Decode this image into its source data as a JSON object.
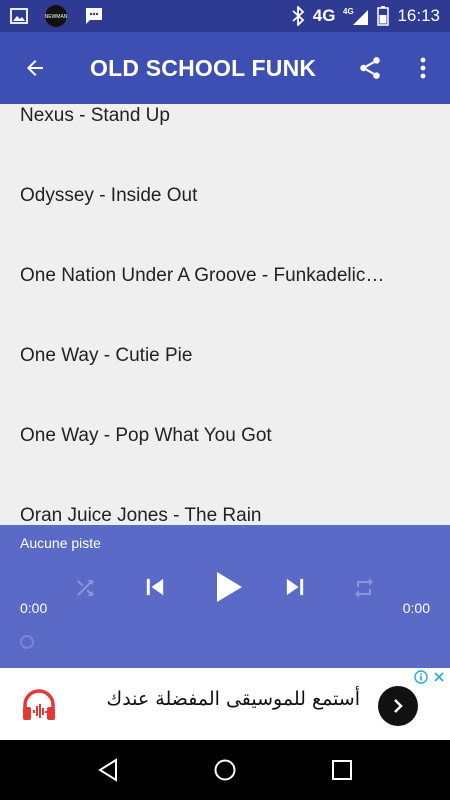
{
  "status_bar": {
    "network": "4G",
    "network_small": "4G",
    "time": "16:13",
    "notification_label": "NEWMAN"
  },
  "app_bar": {
    "title": "OLD SCHOOL FUNK"
  },
  "tracks": [
    "Nexus - Stand Up",
    "Odyssey - Inside Out",
    "One Nation Under A Groove - Funkadelic…",
    "One Way - Cutie Pie",
    "One Way - Pop What You Got",
    "Oran Juice Jones - The Rain"
  ],
  "player": {
    "track_label": "Aucune piste",
    "time_elapsed": "0:00",
    "time_total": "0:00"
  },
  "ad": {
    "text": "أستمع للموسيقى المفضلة عندك"
  },
  "colors": {
    "status_bar": "#2f3b93",
    "app_bar": "#3e4fb4",
    "player": "#5b69c7",
    "list_bg": "#efefef",
    "ad_icon": "#e53935"
  },
  "icons": {
    "back": "arrow-left-icon",
    "share": "share-icon",
    "more": "more-vert-icon",
    "shuffle": "shuffle-icon",
    "previous": "skip-previous-icon",
    "play": "play-icon",
    "next": "skip-next-icon",
    "repeat": "repeat-icon"
  }
}
